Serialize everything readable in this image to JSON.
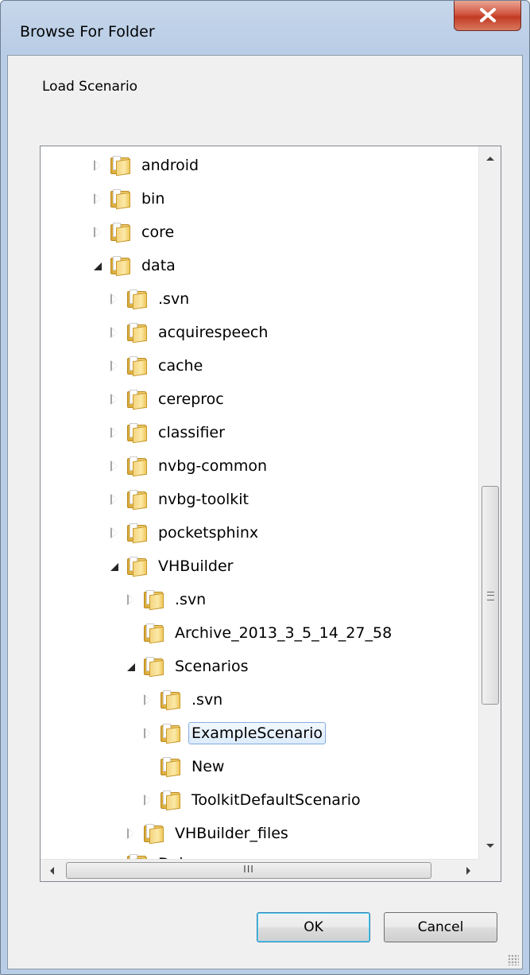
{
  "window": {
    "title": "Browse For Folder",
    "close_glyph": "✕"
  },
  "dialog": {
    "prompt": "Load Scenario",
    "ok_label": "OK",
    "cancel_label": "Cancel"
  },
  "tree": {
    "items": [
      {
        "label": "android",
        "state": "collapsed"
      },
      {
        "label": "bin",
        "state": "collapsed"
      },
      {
        "label": "core",
        "state": "collapsed"
      },
      {
        "label": "data",
        "state": "expanded"
      },
      {
        "label": ".svn",
        "state": "collapsed"
      },
      {
        "label": "acquirespeech",
        "state": "collapsed"
      },
      {
        "label": "cache",
        "state": "collapsed"
      },
      {
        "label": "cereproc",
        "state": "collapsed"
      },
      {
        "label": "classifier",
        "state": "collapsed"
      },
      {
        "label": "nvbg-common",
        "state": "collapsed"
      },
      {
        "label": "nvbg-toolkit",
        "state": "collapsed"
      },
      {
        "label": "pocketsphinx",
        "state": "collapsed"
      },
      {
        "label": "VHBuilder",
        "state": "expanded"
      },
      {
        "label": ".svn",
        "state": "collapsed"
      },
      {
        "label": "Archive_2013_3_5_14_27_58",
        "state": "none"
      },
      {
        "label": "Scenarios",
        "state": "expanded"
      },
      {
        "label": ".svn",
        "state": "collapsed"
      },
      {
        "label": "ExampleScenario",
        "state": "collapsed",
        "selected": true
      },
      {
        "label": "New",
        "state": "none"
      },
      {
        "label": "ToolkitDefaultScenario",
        "state": "collapsed"
      },
      {
        "label": "VHBuilder_files",
        "state": "collapsed"
      },
      {
        "label": "Debug",
        "state": "none"
      }
    ],
    "hscroll_grip": "III"
  }
}
